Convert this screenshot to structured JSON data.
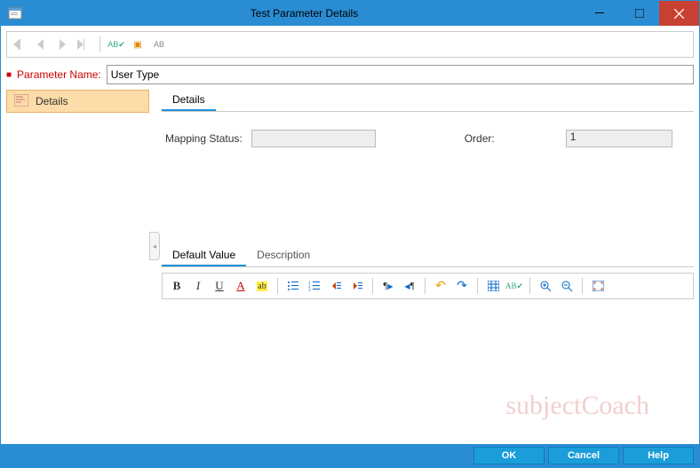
{
  "window": {
    "title": "Test Parameter Details"
  },
  "toolbar": {
    "first": "first-record",
    "prev": "previous-record",
    "next": "next-record",
    "last": "last-record",
    "spellcheck": "spell-check",
    "flag": "flag",
    "clipboard": "clipboard"
  },
  "nameRow": {
    "label": "Parameter Name:",
    "value": "User Type"
  },
  "sidebar": {
    "items": [
      {
        "label": "Details"
      }
    ]
  },
  "detailsPanel": {
    "tab": "Details",
    "mappingStatus": {
      "label": "Mapping Status:",
      "value": ""
    },
    "order": {
      "label": "Order:",
      "value": "1"
    }
  },
  "lowerTabs": {
    "defaultValue": "Default Value",
    "description": "Description"
  },
  "rte": {
    "bold": "B",
    "italic": "I",
    "underline": "U",
    "fontcolor": "A",
    "highlight": "ab"
  },
  "footer": {
    "ok": "OK",
    "cancel": "Cancel",
    "help": "Help"
  },
  "watermark": "subjectCoach"
}
